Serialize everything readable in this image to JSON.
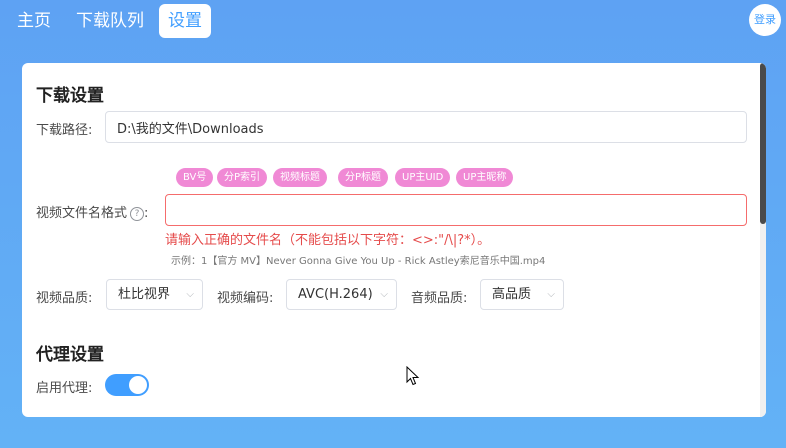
{
  "nav": {
    "tabs": [
      {
        "label": "主页"
      },
      {
        "label": "下载队列"
      },
      {
        "label": "设置"
      }
    ],
    "active_tab": "设置",
    "login_label": "登录"
  },
  "download_settings": {
    "title": "下载设置",
    "path_label": "下载路径:",
    "path_value": "D:\\我的文件\\Downloads",
    "filename_label": "视频文件名格式",
    "filename_label_colon": ":",
    "help_icon_char": "?",
    "chips": [
      "BV号",
      "分P索引",
      "视频标题",
      "分P标题",
      "UP主UID",
      "UP主昵称"
    ],
    "filename_value": "",
    "error_text": "请输入正确的文件名（不能包括以下字符：<>:\"/\\|?*）。",
    "example_text": "示例：1【官方 MV】Never Gonna Give You Up - Rick Astley索尼音乐中国.mp4",
    "quality_label": "视频品质:",
    "quality_value": "杜比视界",
    "codec_label": "视频编码:",
    "codec_value": "AVC(H.264)",
    "audio_label": "音频品质:",
    "audio_value": "高品质"
  },
  "proxy_settings": {
    "title": "代理设置",
    "enable_label": "启用代理:",
    "enabled": true
  },
  "colors": {
    "accent": "#409eff",
    "chip": "#f089d5",
    "error": "#e54b4b"
  }
}
